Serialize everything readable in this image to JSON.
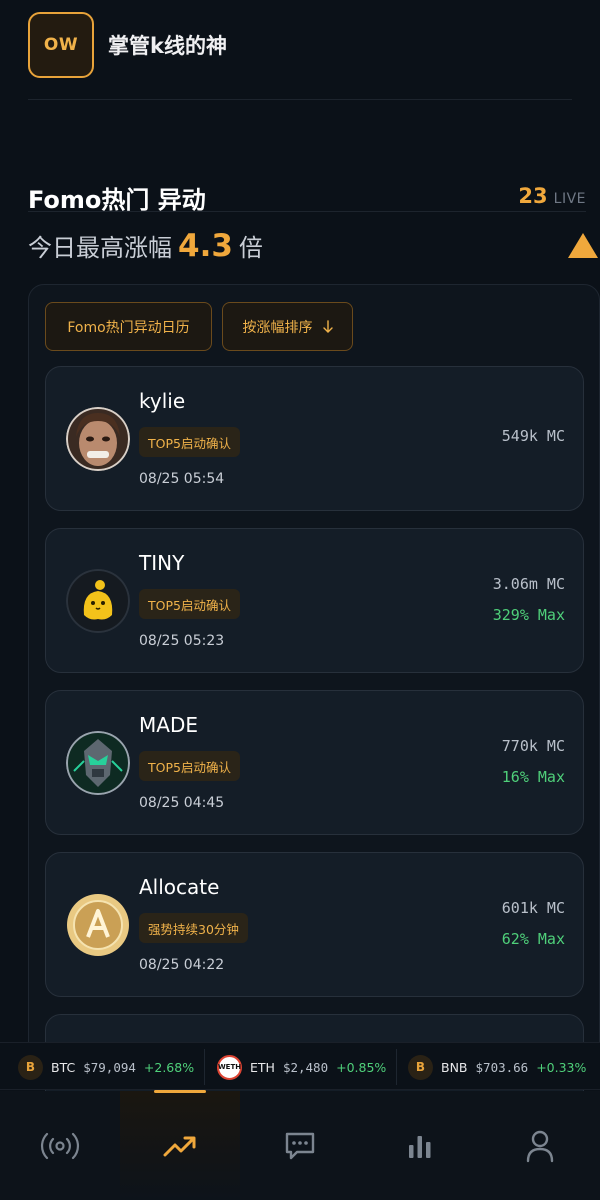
{
  "header": {
    "avatar_initials": "OW",
    "app_name": "掌管k线的神"
  },
  "section": {
    "title": "Fomo热门 异动",
    "live_count": "23",
    "live_label": "LIVE",
    "headline_prefix": "今日最高涨幅",
    "headline_value": "4.3",
    "headline_suffix": "倍"
  },
  "filters": {
    "calendar_label": "Fomo热门异动日历",
    "sort_label": "按涨幅排序",
    "sort_icon": "arrow-down-icon"
  },
  "tokens": [
    {
      "name": "kylie",
      "tag": "TOP5启动确认",
      "time": "08/25 05:54",
      "mc": "549k MC",
      "max": ""
    },
    {
      "name": "TINY",
      "tag": "TOP5启动确认",
      "time": "08/25 05:23",
      "mc": "3.06m MC",
      "max": "329% Max"
    },
    {
      "name": "MADE",
      "tag": "TOP5启动确认",
      "time": "08/25 04:45",
      "mc": "770k MC",
      "max": "16% Max"
    },
    {
      "name": "Allocate",
      "tag": "强势持续30分钟",
      "time": "08/25 04:22",
      "mc": "601k MC",
      "max": "62% Max"
    }
  ],
  "ticker": [
    {
      "icon": "B",
      "symbol": "BTC",
      "price": "$79,094",
      "change": "+2.68%"
    },
    {
      "icon": "WETH",
      "symbol": "ETH",
      "price": "$2,480",
      "change": "+0.85%"
    },
    {
      "icon": "B",
      "symbol": "BNB",
      "price": "$703.66",
      "change": "+0.33%"
    }
  ],
  "nav": {
    "items": [
      "broadcast-icon",
      "trending-icon",
      "chat-icon",
      "bar-chart-icon",
      "profile-icon"
    ],
    "active": "trending-icon"
  },
  "colors": {
    "accent": "#f0a83c",
    "positive": "#4fd07a",
    "background": "#0b1118"
  }
}
